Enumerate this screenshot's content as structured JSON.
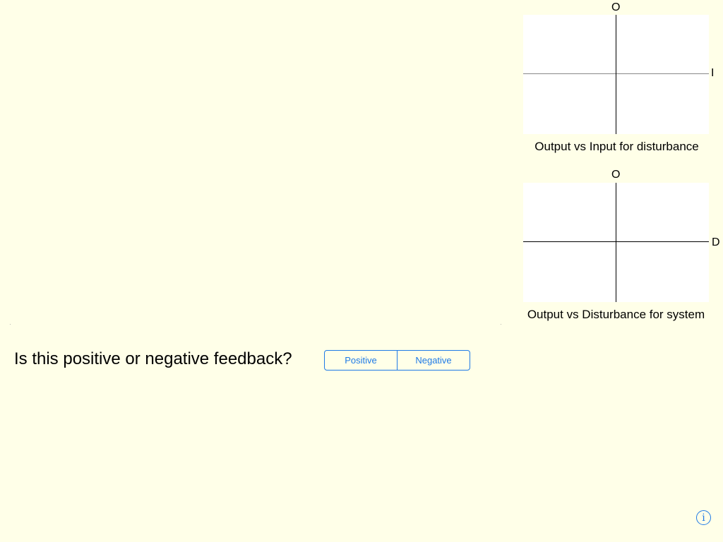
{
  "graphs": {
    "input_graph": {
      "y_axis_label": "O",
      "x_axis_label": "I",
      "caption": "Output vs Input for disturbance",
      "x_axis_color": "#888888"
    },
    "disturbance_graph": {
      "y_axis_label": "O",
      "x_axis_label": "D",
      "caption": "Output vs Disturbance for system",
      "x_axis_color": "#000000"
    }
  },
  "question": {
    "text": "Is this positive or negative feedback?",
    "options": [
      "Positive",
      "Negative"
    ]
  },
  "colors": {
    "background": "#ffffe8",
    "accent": "#1f7ae6"
  },
  "info_button": {
    "icon": "info-icon",
    "label": "i"
  }
}
